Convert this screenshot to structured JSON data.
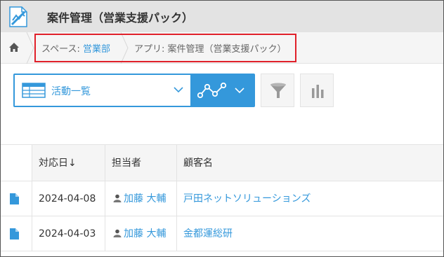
{
  "header": {
    "title": "案件管理（営業支援パック）"
  },
  "breadcrumb": {
    "space_prefix": "スペース: ",
    "space_name": "営業部",
    "app_crumb": "アプリ: 案件管理（営業支援パック）"
  },
  "toolbar": {
    "view_label": "活動一覧"
  },
  "table": {
    "headers": {
      "date": "対応日↓",
      "owner": "担当者",
      "customer": "顧客名"
    },
    "rows": [
      {
        "date": "2024-04-08",
        "owner": "加藤 大輔",
        "customer": "戸田ネットソリューションズ"
      },
      {
        "date": "2024-04-03",
        "owner": "加藤 大輔",
        "customer": "金都運総研"
      }
    ]
  },
  "colors": {
    "accent": "#3498db",
    "highlight": "#e0202a",
    "header_bg": "#e3e3e3"
  },
  "icons": [
    "app-icon",
    "home-icon",
    "table-view-icon",
    "chevron-down-icon",
    "graph-icon",
    "filter-icon",
    "bar-chart-icon",
    "document-icon",
    "person-icon"
  ]
}
